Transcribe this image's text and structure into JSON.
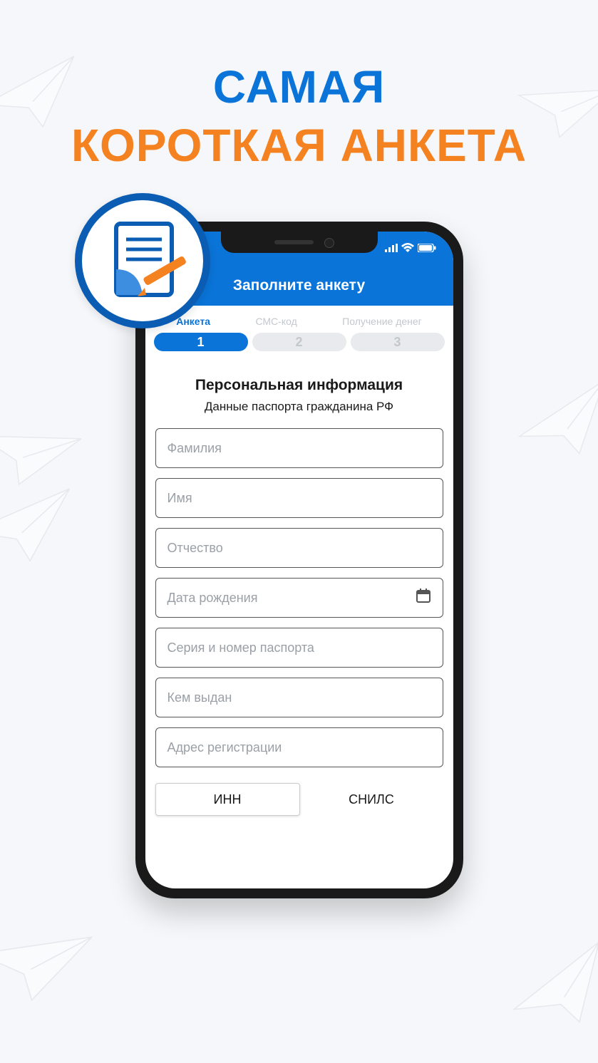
{
  "headline": {
    "line1": "САМАЯ",
    "line2": "КОРОТКАЯ АНКЕТА"
  },
  "app": {
    "header_title": "Заполните анкету",
    "steps": {
      "s1": "Анкета",
      "s2": "СМС-код",
      "s3": "Получение денег",
      "n1": "1",
      "n2": "2",
      "n3": "3"
    },
    "section_title": "Персональная информация",
    "section_subtitle": "Данные паспорта гражданина РФ",
    "fields": {
      "surname": "Фамилия",
      "name": "Имя",
      "patronymic": "Отчество",
      "dob": "Дата рождения",
      "passport": "Серия и  номер паспорта",
      "issued_by": "Кем выдан",
      "address": "Адрес регистрации"
    },
    "tabs": {
      "inn": "ИНН",
      "snils": "СНИЛС"
    }
  }
}
